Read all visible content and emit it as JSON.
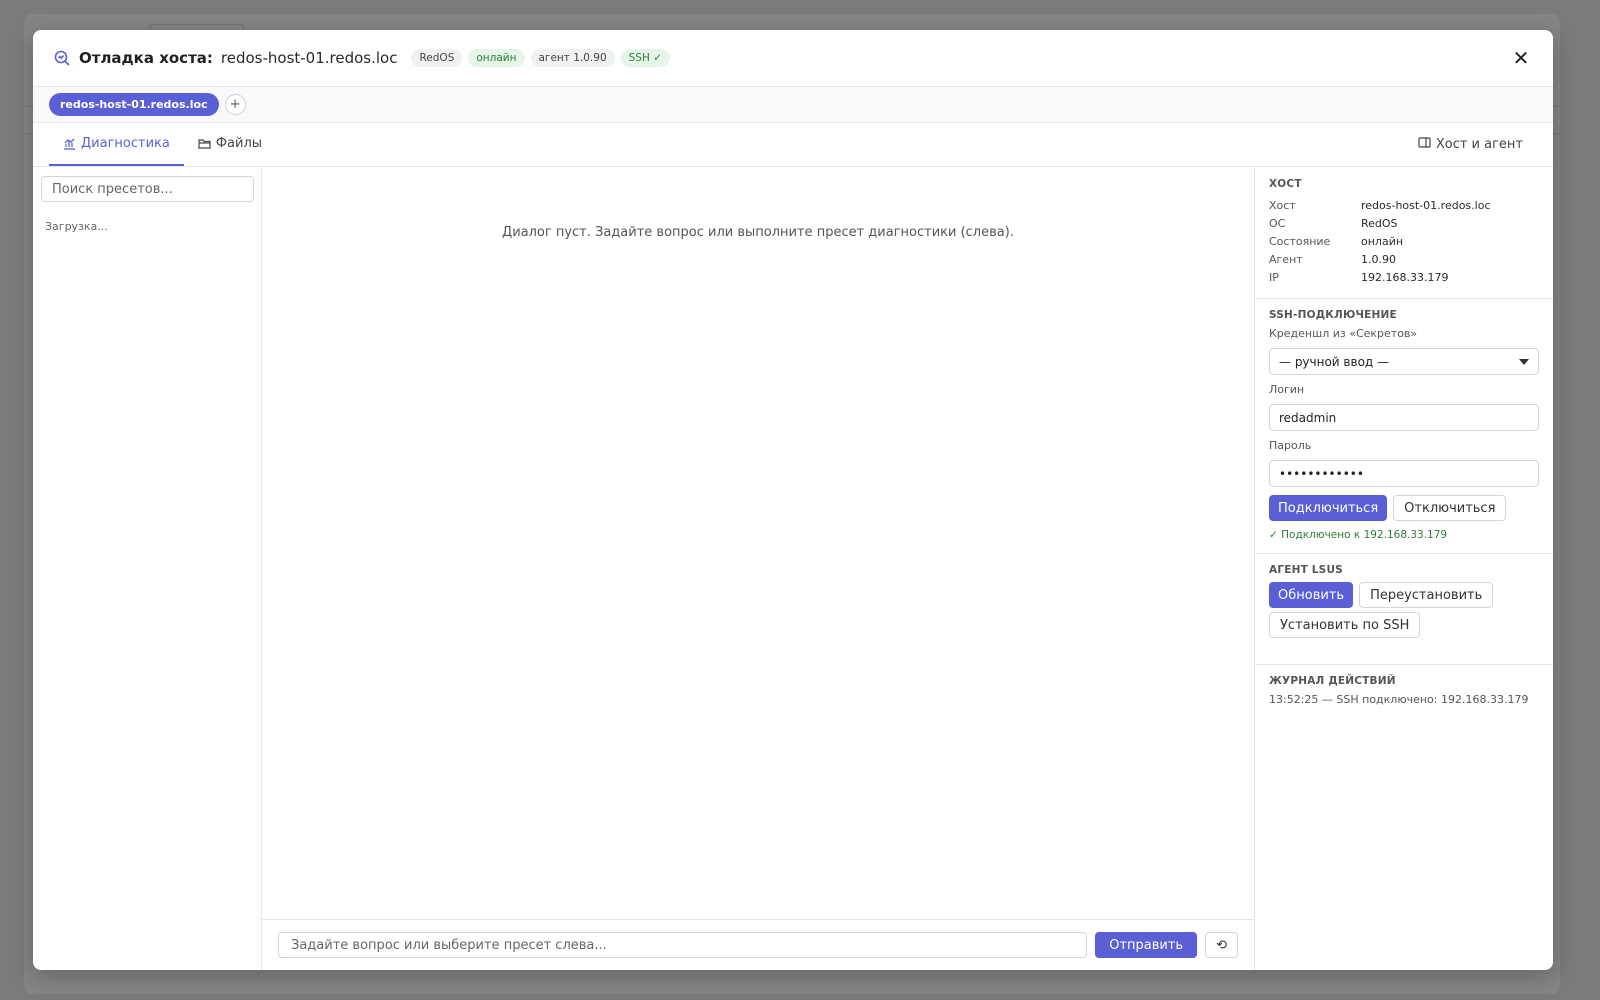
{
  "header": {
    "title_label": "Отладка хоста:",
    "host": "redos-host-01.redos.loc",
    "badges": [
      "RedOS",
      "онлайн",
      "агент 1.0.90",
      "SSH ✓"
    ]
  },
  "hostbar": {
    "active_host": "redos-host-01.redos.loc",
    "add_label": "+"
  },
  "tabs": [
    {
      "label": "Диагностика",
      "active": true
    },
    {
      "label": "Файлы",
      "active": false
    }
  ],
  "tabs_right": {
    "label": "Хост и агент"
  },
  "presets": {
    "search_placeholder": "Поиск пресетов...",
    "loading": "Загрузка..."
  },
  "dialog": {
    "empty_text": "Диалог пуст. Задайте вопрос или выполните пресет диагностики (слева).",
    "input_placeholder": "Задайте вопрос или выберите пресет слева...",
    "send_label": "Отправить",
    "reset_label": "⟲"
  },
  "host_section": {
    "title": "Хост",
    "rows": [
      {
        "k": "Хост",
        "v": "redos-host-01.redos.loc"
      },
      {
        "k": "ОС",
        "v": "RedOS"
      },
      {
        "k": "Состояние",
        "v": "онлайн"
      },
      {
        "k": "Агент",
        "v": "1.0.90"
      },
      {
        "k": "IP",
        "v": "192.168.33.179"
      }
    ]
  },
  "ssh_section": {
    "title": "SSH-подключение",
    "cred_label": "Креденшл из «Секретов»",
    "cred_value": "— ручной ввод —",
    "login_label": "Логин",
    "login_value": "redadmin",
    "password_label": "Пароль",
    "password_value": "••••••••••••",
    "connect_label": "Подключиться",
    "disconnect_label": "Отключиться",
    "status": "✓ Подключено к 192.168.33.179"
  },
  "agent_section": {
    "title": "Агент LSUS",
    "update_label": "Обновить",
    "reinstall_label": "Переустановить",
    "install_ssh_label": "Установить по SSH"
  },
  "log_section": {
    "title": "Журнал действий",
    "entries": [
      "13:52:25 — SSH подключено: 192.168.33.179"
    ]
  },
  "colors": {
    "accent": "#5b5fd6",
    "success": "#2e7d32",
    "overlay": "#7b7b7b"
  }
}
